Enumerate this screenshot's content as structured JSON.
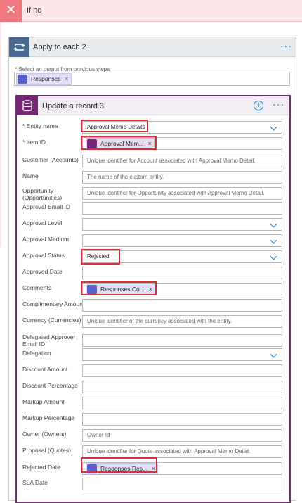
{
  "branch": {
    "title": "If no"
  },
  "apply_each": {
    "title": "Apply to each 2",
    "select_label": "Select an output from previous steps",
    "token": "Responses"
  },
  "update_record": {
    "title": "Update a record 3",
    "fields": [
      {
        "label": "Entity name",
        "required": true,
        "value": "Approval Memo Details",
        "placeholder": "",
        "dropdown": true
      },
      {
        "label": "Item ID",
        "required": true,
        "token": "Approval Mem...",
        "token_type": "db"
      },
      {
        "label": "Customer (Accounts)",
        "placeholder": "Unique identifier for Account associated with Approval Memo Detail."
      },
      {
        "label": "Name",
        "placeholder": "The name of the custom entity."
      },
      {
        "label": "Opportunity (Opportunities)",
        "placeholder": "Unique identifier for Opportunity associated with Approval Memo Detail."
      },
      {
        "label": "Approval Email ID",
        "placeholder": ""
      },
      {
        "label": "Approval Level",
        "placeholder": "",
        "dropdown": true
      },
      {
        "label": "Approval Medium",
        "placeholder": "",
        "dropdown": true
      },
      {
        "label": "Approval Status",
        "value": "Rejected",
        "dropdown": true
      },
      {
        "label": "Approved Date",
        "placeholder": ""
      },
      {
        "label": "Comments",
        "token": "Responses Co...",
        "token_type": "forms"
      },
      {
        "label": "Complimentary Amount",
        "placeholder": ""
      },
      {
        "label": "Currency (Currencies)",
        "placeholder": "Unique identifier of the currency associated with the entity."
      },
      {
        "label": "Delegated Approver Email ID",
        "placeholder": ""
      },
      {
        "label": "Delegation",
        "placeholder": "",
        "dropdown": true
      },
      {
        "label": "Discount Amount",
        "placeholder": ""
      },
      {
        "label": "Discount Percentage",
        "placeholder": ""
      },
      {
        "label": "Markup Amount",
        "placeholder": ""
      },
      {
        "label": "Markup Percentage",
        "placeholder": ""
      },
      {
        "label": "Owner (Owners)",
        "placeholder": "Owner Id"
      },
      {
        "label": "Proposal (Quotes)",
        "placeholder": "Unique identifier for Quote associated with Approval Memo Detail."
      },
      {
        "label": "Rejected Date",
        "token": "Responses Res...",
        "token_type": "forms"
      },
      {
        "label": "SLA Date",
        "placeholder": ""
      }
    ]
  },
  "colors": {
    "branch_red": "#f0767f",
    "dataverse_purple": "#742774",
    "accent_blue": "#0078d4",
    "highlight_red": "#d13438"
  }
}
